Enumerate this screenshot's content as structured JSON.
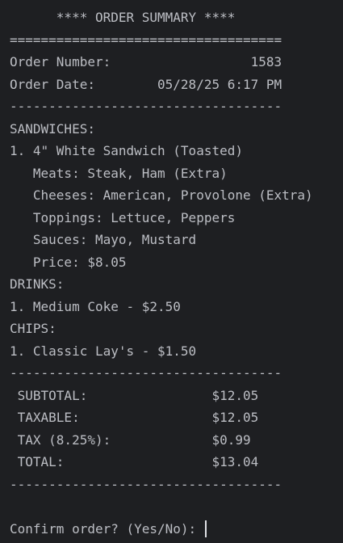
{
  "terminal": {
    "lines": [
      "      **** ORDER SUMMARY ****",
      "===================================",
      "Order Number:                  1583",
      "Order Date:        05/28/25 6:17 PM",
      "-----------------------------------",
      "SANDWICHES:",
      "1. 4\" White Sandwich (Toasted)",
      "   Meats: Steak, Ham (Extra)",
      "   Cheeses: American, Provolone (Extra)",
      "   Toppings: Lettuce, Peppers",
      "   Sauces: Mayo, Mustard",
      "   Price: $8.05",
      "DRINKS:",
      "1. Medium Coke - $2.50",
      "CHIPS:",
      "1. Classic Lay's - $1.50",
      "-----------------------------------",
      " SUBTOTAL:                $12.05",
      " TAXABLE:                 $12.05",
      " TAX (8.25%):             $0.99",
      " TOTAL:                   $13.04",
      "-----------------------------------",
      ""
    ],
    "prompt": "Confirm order? (Yes/No): "
  }
}
